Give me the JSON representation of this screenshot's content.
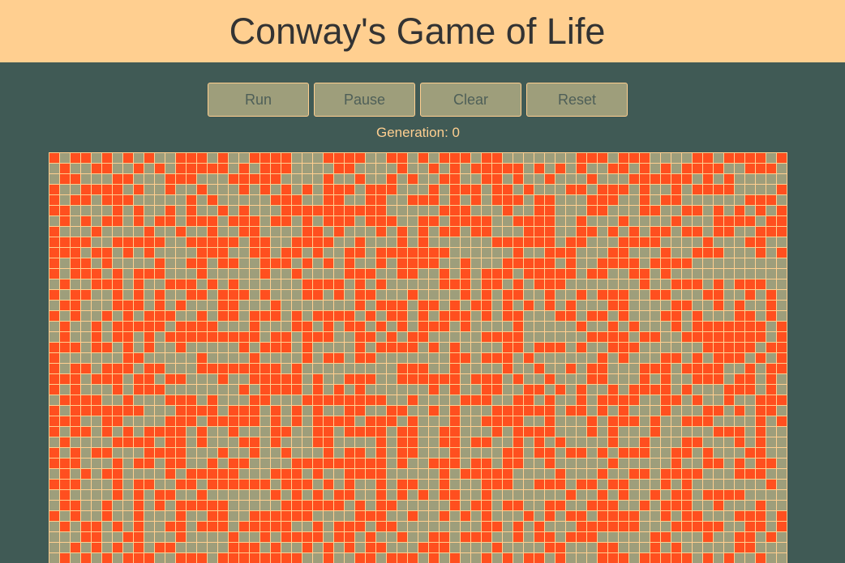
{
  "header": {
    "title": "Conway's Game of Life"
  },
  "controls": {
    "run_label": "Run",
    "pause_label": "Pause",
    "clear_label": "Clear",
    "reset_label": "Reset"
  },
  "status": {
    "generation_text": "Generation: 0"
  },
  "board": {
    "columns": 70,
    "visible_rows": 39,
    "alive_color": "#ff4f1f",
    "dead_color": "#9e9e7b",
    "grid_line_color": "#ffcf90"
  }
}
